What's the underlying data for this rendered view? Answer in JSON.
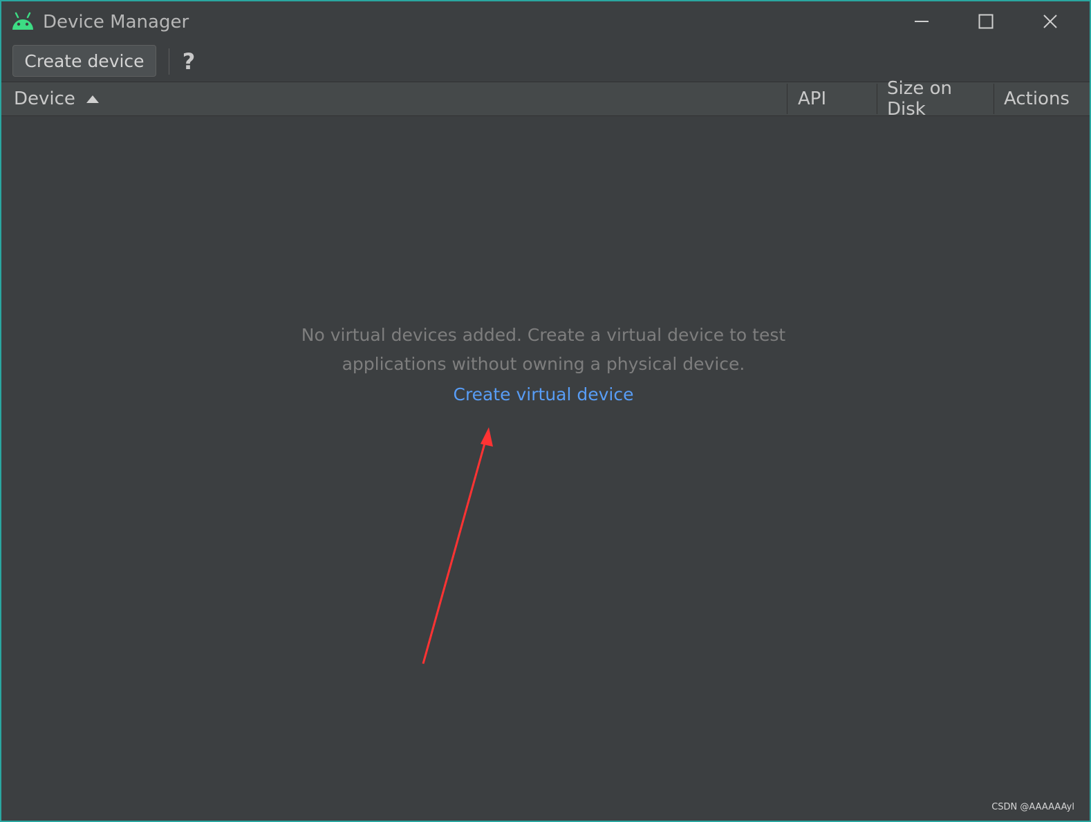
{
  "window": {
    "title": "Device Manager",
    "border_color": "#2aa7a0",
    "icon": "android-icon"
  },
  "window_controls": {
    "minimize_icon": "minimize-icon",
    "maximize_icon": "maximize-icon",
    "close_icon": "close-icon"
  },
  "toolbar": {
    "create_label": "Create device",
    "help_label": "?"
  },
  "table": {
    "columns": [
      "Device",
      "API",
      "Size on Disk",
      "Actions"
    ],
    "sort_column": "Device",
    "sort_direction": "ascending"
  },
  "empty_state": {
    "message_line1": "No virtual devices added. Create a virtual device to test",
    "message_line2": "applications without owning a physical device.",
    "link_label": "Create virtual device",
    "link_color": "#589df6"
  },
  "annotation": {
    "arrow_color": "#ff3333"
  },
  "watermark": "CSDN @AAAAAAyl"
}
